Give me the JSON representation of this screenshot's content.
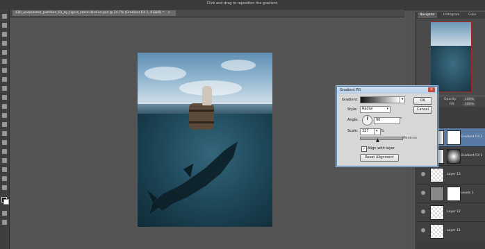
{
  "app": {
    "hint_text": "Click and drag to reposition the gradient.",
    "document_tab": "430_underwater_partition_01_by_tigers_stock-d4e4ud.psd @ 24.7% (Gradient Fill 1, RGB/8) *",
    "document_tab_close": "×"
  },
  "panels": {
    "navigator_tabs": [
      "Navigator",
      "Histogram",
      "Color"
    ]
  },
  "layers_panel": {
    "opacity_label": "Opacity:",
    "opacity_value": "100%",
    "fill_label": "Fill:",
    "fill_value": "100%",
    "rows": [
      {
        "name": "Gradient Fill 2"
      },
      {
        "name": "Gradient Fill 1"
      },
      {
        "name": "Layer 13"
      },
      {
        "name": "Levels 1"
      },
      {
        "name": "Layer 12"
      },
      {
        "name": "Layer 11"
      }
    ]
  },
  "dialog": {
    "title": "Gradient Fill",
    "close": "x",
    "gradient_label": "Gradient:",
    "style_label": "Style:",
    "style_value": "Radial",
    "angle_label": "Angle:",
    "angle_value": "90",
    "angle_unit": "°",
    "scale_label": "Scale:",
    "scale_value": "327",
    "scale_unit": "%",
    "reverse_label": "Reverse",
    "align_label": "Align with layer",
    "reset_button": "Reset Alignment",
    "ok_button": "OK",
    "cancel_button": "Cancel"
  }
}
